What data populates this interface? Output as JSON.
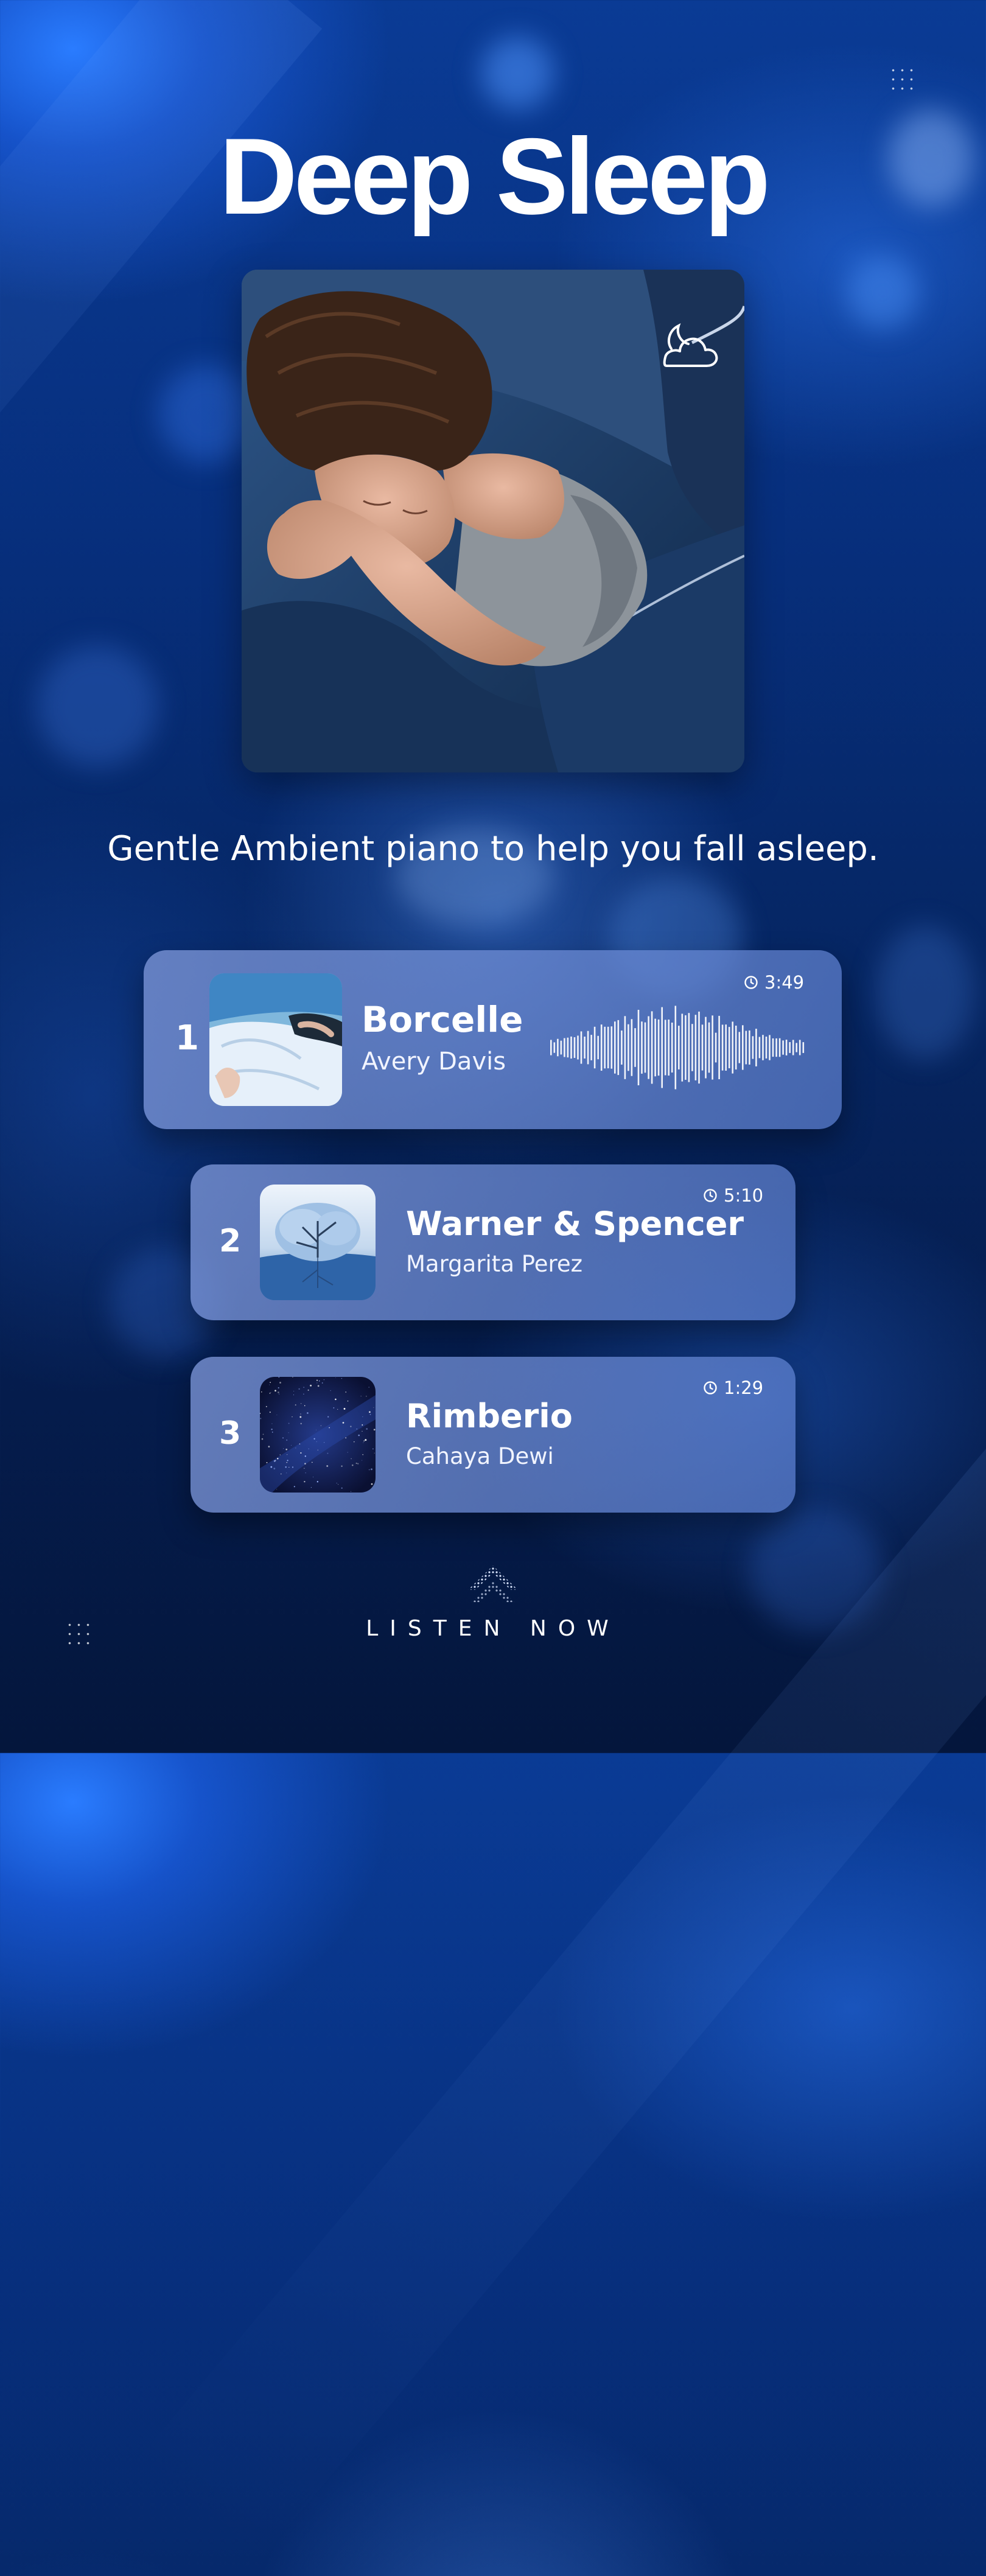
{
  "page": {
    "title": "Deep Sleep",
    "subtitle": "Gentle Ambient piano to help you fall asleep.",
    "cta_label": "LISTEN NOW"
  },
  "icons": {
    "cover_overlay": "cloud-moon-icon",
    "duration": "clock-icon",
    "cta": "chevron-up-icon",
    "decoration": "dot-grid-icon"
  },
  "tracks": [
    {
      "number": "1",
      "title": "Borcelle",
      "artist": "Avery Davis",
      "duration": "3:49"
    },
    {
      "number": "2",
      "title": "Warner & Spencer",
      "artist": "Margarita Perez",
      "duration": "5:10"
    },
    {
      "number": "3",
      "title": "Rimberio",
      "artist": "Cahaya Dewi",
      "duration": "1:29"
    }
  ],
  "colors": {
    "background_top": "#0a3b95",
    "background_bottom": "#04163c",
    "card": "#7d96d7",
    "text": "#ffffff"
  }
}
